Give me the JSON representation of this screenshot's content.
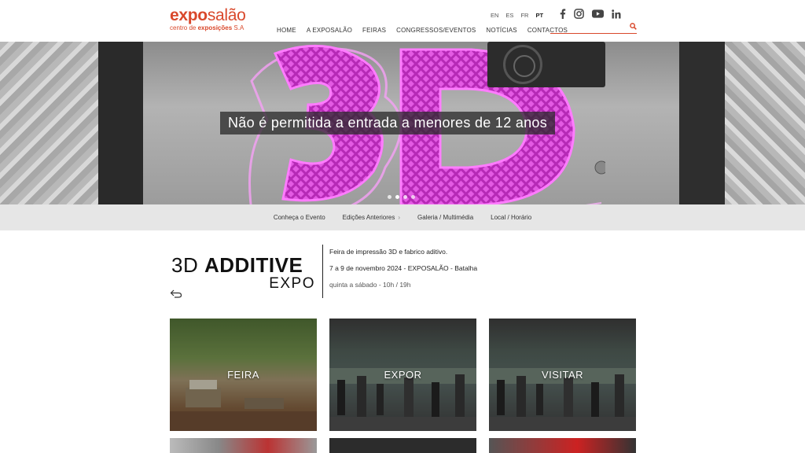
{
  "header": {
    "logo": {
      "brand_a": "expo",
      "brand_b": "salão",
      "tagline_a": "centro de ",
      "tagline_b": "exposições",
      "tagline_c": " S.A"
    },
    "languages": [
      {
        "code": "EN",
        "active": false
      },
      {
        "code": "ES",
        "active": false
      },
      {
        "code": "FR",
        "active": false
      },
      {
        "code": "PT",
        "active": true
      }
    ],
    "nav": [
      "HOME",
      "A EXPOSALÃO",
      "FEIRAS",
      "CONGRESSOS/EVENTOS",
      "NOTÍCIAS",
      "CONTACTOS"
    ],
    "social": [
      "facebook-icon",
      "instagram-icon",
      "youtube-icon",
      "linkedin-icon"
    ],
    "search": {
      "placeholder": ""
    }
  },
  "hero": {
    "caption": "Não é permitida a entrada a menores de 12 anos",
    "slides": 4,
    "active_slide": 1
  },
  "subnav": {
    "items": [
      "Conheça o Evento",
      "Edições Anteriores",
      "Galeria / Multimédia",
      "Local / Horário"
    ]
  },
  "event": {
    "name_part1": "3D ",
    "name_part2": "ADDITIVE",
    "name_part3": "EXPO",
    "description": "Feira de impressão 3D e fabrico aditivo.",
    "dates": "7 a 9 de novembro 2024 - EXPOSALÃO - Batalha",
    "hours": "quinta a sábado - 10h / 19h"
  },
  "tiles": [
    {
      "label": "FEIRA"
    },
    {
      "label": "EXPOR"
    },
    {
      "label": "VISITAR"
    }
  ],
  "colors": {
    "brand": "#d9482b",
    "subnav_bg": "#e6e6e6",
    "magenta": "#e040e0"
  }
}
